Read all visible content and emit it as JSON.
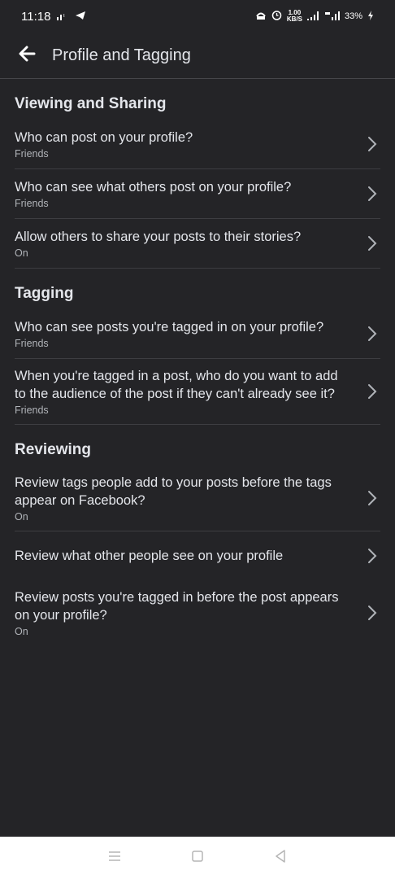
{
  "status_bar": {
    "time": "11:18",
    "network_speed_value": "1.00",
    "network_speed_unit": "KB/S",
    "battery": "33%"
  },
  "header": {
    "title": "Profile and Tagging"
  },
  "sections": [
    {
      "title": "Viewing and Sharing",
      "items": [
        {
          "label": "Who can post on your profile?",
          "value": "Friends"
        },
        {
          "label": "Who can see what others post on your profile?",
          "value": "Friends"
        },
        {
          "label": "Allow others to share your posts to their stories?",
          "value": "On"
        }
      ]
    },
    {
      "title": "Tagging",
      "items": [
        {
          "label": "Who can see posts you're tagged in on your profile?",
          "value": "Friends"
        },
        {
          "label": "When you're tagged in a post, who do you want to add to the audience of the post if they can't already see it?",
          "value": "Friends"
        }
      ]
    },
    {
      "title": "Reviewing",
      "items": [
        {
          "label": "Review tags people add to your posts before the tags appear on Facebook?",
          "value": "On"
        },
        {
          "label": "Review what other people see on your profile",
          "value": ""
        },
        {
          "label": "Review posts you're tagged in before the post appears on your profile?",
          "value": "On"
        }
      ]
    }
  ],
  "icons": {
    "back": "arrow-left-icon",
    "chevron": "chevron-right-icon",
    "nav_menu": "menu-icon",
    "nav_home": "home-square-icon",
    "nav_back": "back-triangle-icon"
  }
}
